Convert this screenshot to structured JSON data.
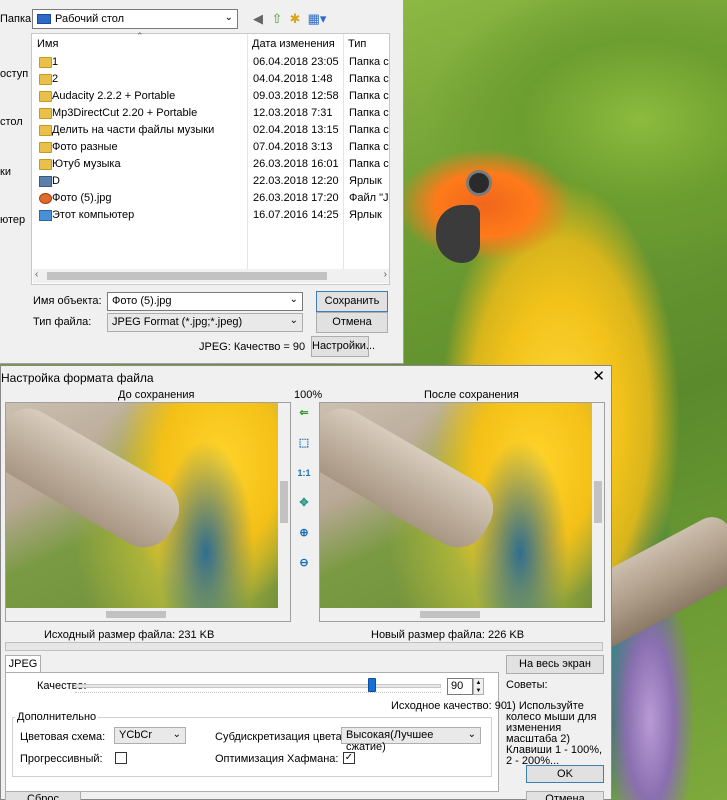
{
  "save_dialog": {
    "folder_label": "Папка:",
    "folder_value": "Рабочий стол",
    "left_nav_stubs": [
      "оступ",
      "стол",
      "ки",
      "ютер"
    ],
    "columns": {
      "name": "Имя",
      "date": "Дата изменения",
      "type": "Тип"
    },
    "files": [
      {
        "name": "1",
        "date": "06.04.2018 23:05",
        "type": "Папка с ф",
        "icon": "folder-icon"
      },
      {
        "name": "2",
        "date": "04.04.2018 1:48",
        "type": "Папка с ф",
        "icon": "folder-icon"
      },
      {
        "name": "Audacity 2.2.2 + Portable",
        "date": "09.03.2018 12:58",
        "type": "Папка с ф",
        "icon": "folder-icon"
      },
      {
        "name": "Mp3DirectCut 2.20 + Portable",
        "date": "12.03.2018 7:31",
        "type": "Папка с ф",
        "icon": "folder-icon"
      },
      {
        "name": "Делить на части файлы музыки",
        "date": "02.04.2018 13:15",
        "type": "Папка с ф",
        "icon": "folder-icon"
      },
      {
        "name": "Фото разные",
        "date": "07.04.2018 3:13",
        "type": "Папка с ф",
        "icon": "folder-icon"
      },
      {
        "name": "Ютуб музыка",
        "date": "26.03.2018 16:01",
        "type": "Папка с ф",
        "icon": "folder-icon"
      },
      {
        "name": "D",
        "date": "22.03.2018 12:20",
        "type": "Ярлык",
        "icon": "drive-icon"
      },
      {
        "name": "Фото (5).jpg",
        "date": "26.03.2018 17:20",
        "type": "Файл \"JPE",
        "icon": "jpg-icon"
      },
      {
        "name": "Этот компьютер",
        "date": "16.07.2016 14:25",
        "type": "Ярлык",
        "icon": "computer-icon"
      }
    ],
    "filename_label": "Имя объекта:",
    "filename_value": "Фото (5).jpg",
    "filetype_label": "Тип файла:",
    "filetype_value": "JPEG Format (*.jpg;*.jpeg)",
    "save_button": "Сохранить",
    "cancel_button": "Отмена",
    "quality_status": "JPEG: Качество = 90",
    "settings_button": "Настройки..."
  },
  "format_dialog": {
    "title": "Настройка формата файла",
    "close": "✕",
    "before_label": "До сохранения",
    "zoom_label": "100%",
    "after_label": "После сохранения",
    "tool_1to1": "1:1",
    "orig_size": "Исходный размер файла:  231 KB",
    "new_size": "Новый размер файла:  226 KB",
    "tab_jpeg": "JPEG",
    "quality_label": "Качество:",
    "quality_value": "90",
    "quality_fraction": 0.9,
    "orig_quality": "Исходное качество: 90",
    "group_title": "Дополнительно",
    "color_scheme_label": "Цветовая схема:",
    "color_scheme_value": "YCbCr",
    "subsampling_label": "Субдискретизация цвета:",
    "subsampling_value": "Высокая(Лучшее сжатие)",
    "progressive_label": "Прогрессивный:",
    "progressive_checked": false,
    "huffman_label": "Оптимизация Хафмана:",
    "huffman_checked": true,
    "fullscreen_button": "На весь экран",
    "tips_title": "Советы:",
    "tips_text": "1) Используйте колесо мыши для изменения масштаба 2) Клавиши 1 - 100%, 2 - 200%...",
    "ok_button": "OK",
    "reset_button": "Сброс",
    "cancel_button": "Отмена"
  },
  "colors": {
    "accent": "#1270d8",
    "arrow": "#e02020"
  }
}
